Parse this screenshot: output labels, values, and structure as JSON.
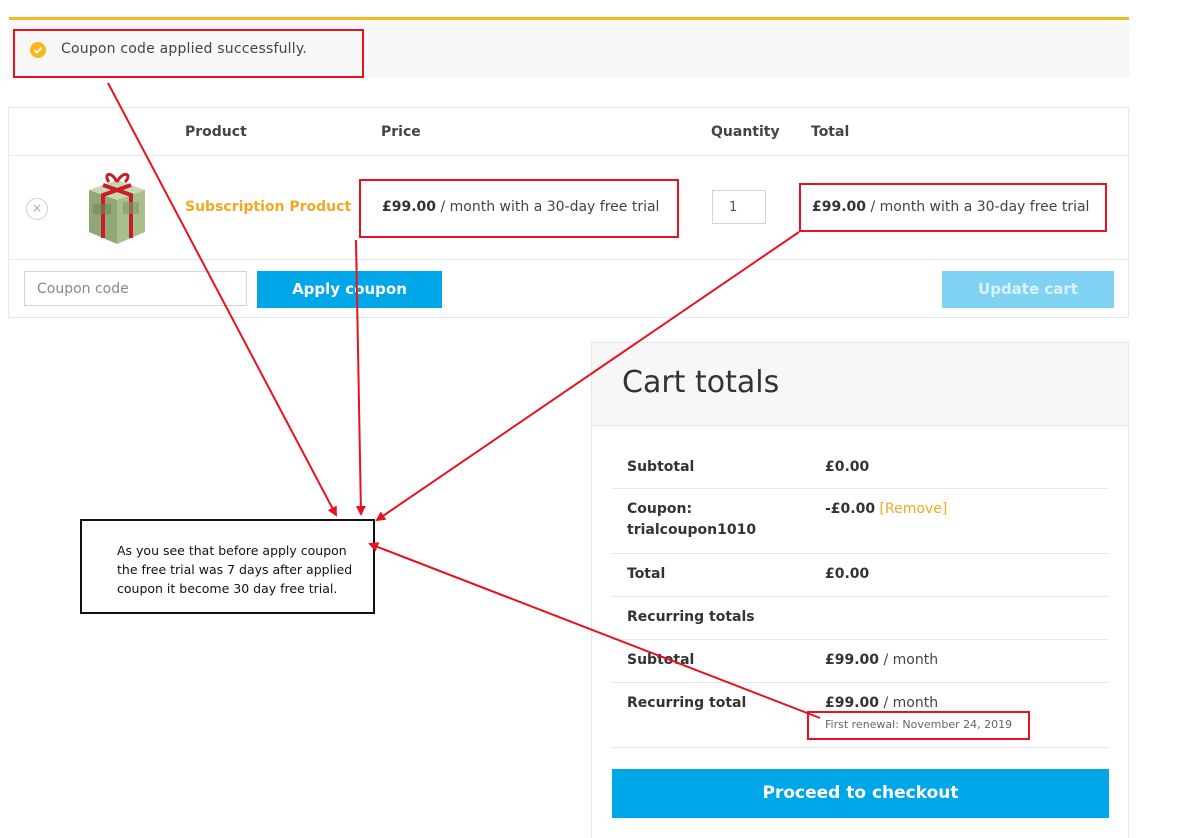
{
  "notice": {
    "icon": "check-circle-icon",
    "message": "Coupon code applied successfully."
  },
  "cart": {
    "columns": {
      "product": "Product",
      "price": "Price",
      "quantity": "Quantity",
      "total": "Total"
    },
    "item": {
      "remove_symbol": "×",
      "image_icon": "gift-box-money-image",
      "name": "Subscription Product",
      "price_amount": "£99.00",
      "price_suffix": " / month with a 30-day free trial",
      "quantity": "1",
      "total_amount": "£99.00",
      "total_suffix": " / month with a 30-day free trial"
    },
    "coupon_placeholder": "Coupon code",
    "apply_label": "Apply coupon",
    "update_label": "Update cart"
  },
  "totals": {
    "title": "Cart totals",
    "subtotal_label": "Subtotal",
    "subtotal_value": "£0.00",
    "coupon_label_line1": "Coupon:",
    "coupon_label_line2": "trialcoupon1010",
    "coupon_value": "-£0.00",
    "coupon_remove": "[Remove]",
    "total_label": "Total",
    "total_value": "£0.00",
    "recurring_heading": "Recurring totals",
    "rec_subtotal_label": "Subtotal",
    "rec_subtotal_amount": "£99.00",
    "rec_subtotal_suffix": " / month",
    "rec_total_label": "Recurring total",
    "rec_total_amount": "£99.00",
    "rec_total_suffix": " / month",
    "first_renewal": "First renewal: November 24, 2019",
    "checkout_label": "Proceed to checkout"
  },
  "annotation": {
    "note": "As you see that before apply coupon the free trial was 7 days after applied coupon it become 30 day free trial.",
    "highlight_color": "#e8121e"
  },
  "colors": {
    "accent_blue": "#00a7e8",
    "accent_orange": "#f6a623",
    "notice_yellow": "#f6b81c"
  }
}
